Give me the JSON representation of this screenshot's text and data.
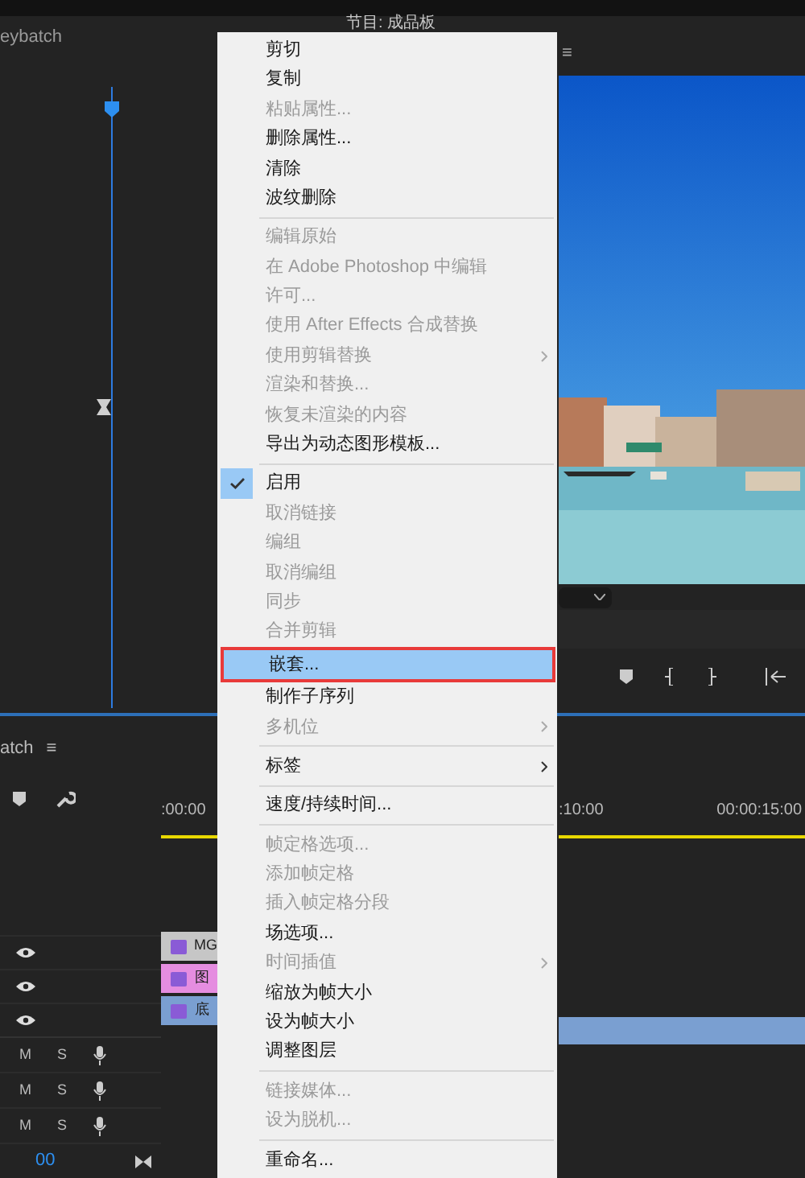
{
  "source_panel": {
    "title": "eybatch"
  },
  "program_panel": {
    "title": "节目: 成品板",
    "menu_glyph": "≡"
  },
  "timeline": {
    "title": "atch",
    "menu_glyph": "≡",
    "timecodes": [
      ":00:00",
      ":10:00",
      "00:00:15:00"
    ],
    "clips": [
      {
        "label": "MG",
        "color": "#c6c6c6"
      },
      {
        "label": "图",
        "color": "#e58de0"
      },
      {
        "label": "底",
        "color": "#7a9fd1"
      }
    ],
    "audio_tracks": [
      {
        "mute": "M",
        "solo": "S"
      },
      {
        "mute": "M",
        "solo": "S"
      },
      {
        "mute": "M",
        "solo": "S"
      }
    ],
    "time_value": "00"
  },
  "context_menu": {
    "items": [
      {
        "kind": "item",
        "label": "剪切",
        "disabled": false
      },
      {
        "kind": "item",
        "label": "复制",
        "disabled": false
      },
      {
        "kind": "item",
        "label": "粘贴属性...",
        "disabled": true
      },
      {
        "kind": "item",
        "label": "删除属性...",
        "disabled": false
      },
      {
        "kind": "item",
        "label": "清除",
        "disabled": false
      },
      {
        "kind": "item",
        "label": "波纹删除",
        "disabled": false
      },
      {
        "kind": "separator"
      },
      {
        "kind": "item",
        "label": "编辑原始",
        "disabled": true
      },
      {
        "kind": "item",
        "label": "在 Adobe Photoshop 中编辑",
        "disabled": true
      },
      {
        "kind": "item",
        "label": "许可...",
        "disabled": true
      },
      {
        "kind": "item",
        "label": "使用 After Effects 合成替换",
        "disabled": true
      },
      {
        "kind": "item",
        "label": "使用剪辑替换",
        "disabled": true,
        "submenu": true
      },
      {
        "kind": "item",
        "label": "渲染和替换...",
        "disabled": true
      },
      {
        "kind": "item",
        "label": "恢复未渲染的内容",
        "disabled": true
      },
      {
        "kind": "item",
        "label": "导出为动态图形模板...",
        "disabled": false
      },
      {
        "kind": "separator"
      },
      {
        "kind": "item",
        "label": "启用",
        "disabled": false,
        "checked": true
      },
      {
        "kind": "item",
        "label": "取消链接",
        "disabled": true
      },
      {
        "kind": "item",
        "label": "编组",
        "disabled": true
      },
      {
        "kind": "item",
        "label": "取消编组",
        "disabled": true
      },
      {
        "kind": "item",
        "label": "同步",
        "disabled": true
      },
      {
        "kind": "item",
        "label": "合并剪辑",
        "disabled": true
      },
      {
        "kind": "item",
        "label": "嵌套...",
        "disabled": false,
        "selected": true,
        "annotated": true
      },
      {
        "kind": "item",
        "label": "制作子序列",
        "disabled": false
      },
      {
        "kind": "item",
        "label": "多机位",
        "disabled": true,
        "submenu": true
      },
      {
        "kind": "separator"
      },
      {
        "kind": "item",
        "label": "标签",
        "disabled": false,
        "submenu": true
      },
      {
        "kind": "separator"
      },
      {
        "kind": "item",
        "label": "速度/持续时间...",
        "disabled": false
      },
      {
        "kind": "separator"
      },
      {
        "kind": "item",
        "label": "帧定格选项...",
        "disabled": true
      },
      {
        "kind": "item",
        "label": "添加帧定格",
        "disabled": true
      },
      {
        "kind": "item",
        "label": "插入帧定格分段",
        "disabled": true
      },
      {
        "kind": "item",
        "label": "场选项...",
        "disabled": false
      },
      {
        "kind": "item",
        "label": "时间插值",
        "disabled": true,
        "submenu": true
      },
      {
        "kind": "item",
        "label": "缩放为帧大小",
        "disabled": false
      },
      {
        "kind": "item",
        "label": "设为帧大小",
        "disabled": false
      },
      {
        "kind": "item",
        "label": "调整图层",
        "disabled": false
      },
      {
        "kind": "separator"
      },
      {
        "kind": "item",
        "label": "链接媒体...",
        "disabled": true
      },
      {
        "kind": "item",
        "label": "设为脱机...",
        "disabled": true
      },
      {
        "kind": "separator"
      },
      {
        "kind": "item",
        "label": "重命名...",
        "disabled": false
      }
    ]
  }
}
